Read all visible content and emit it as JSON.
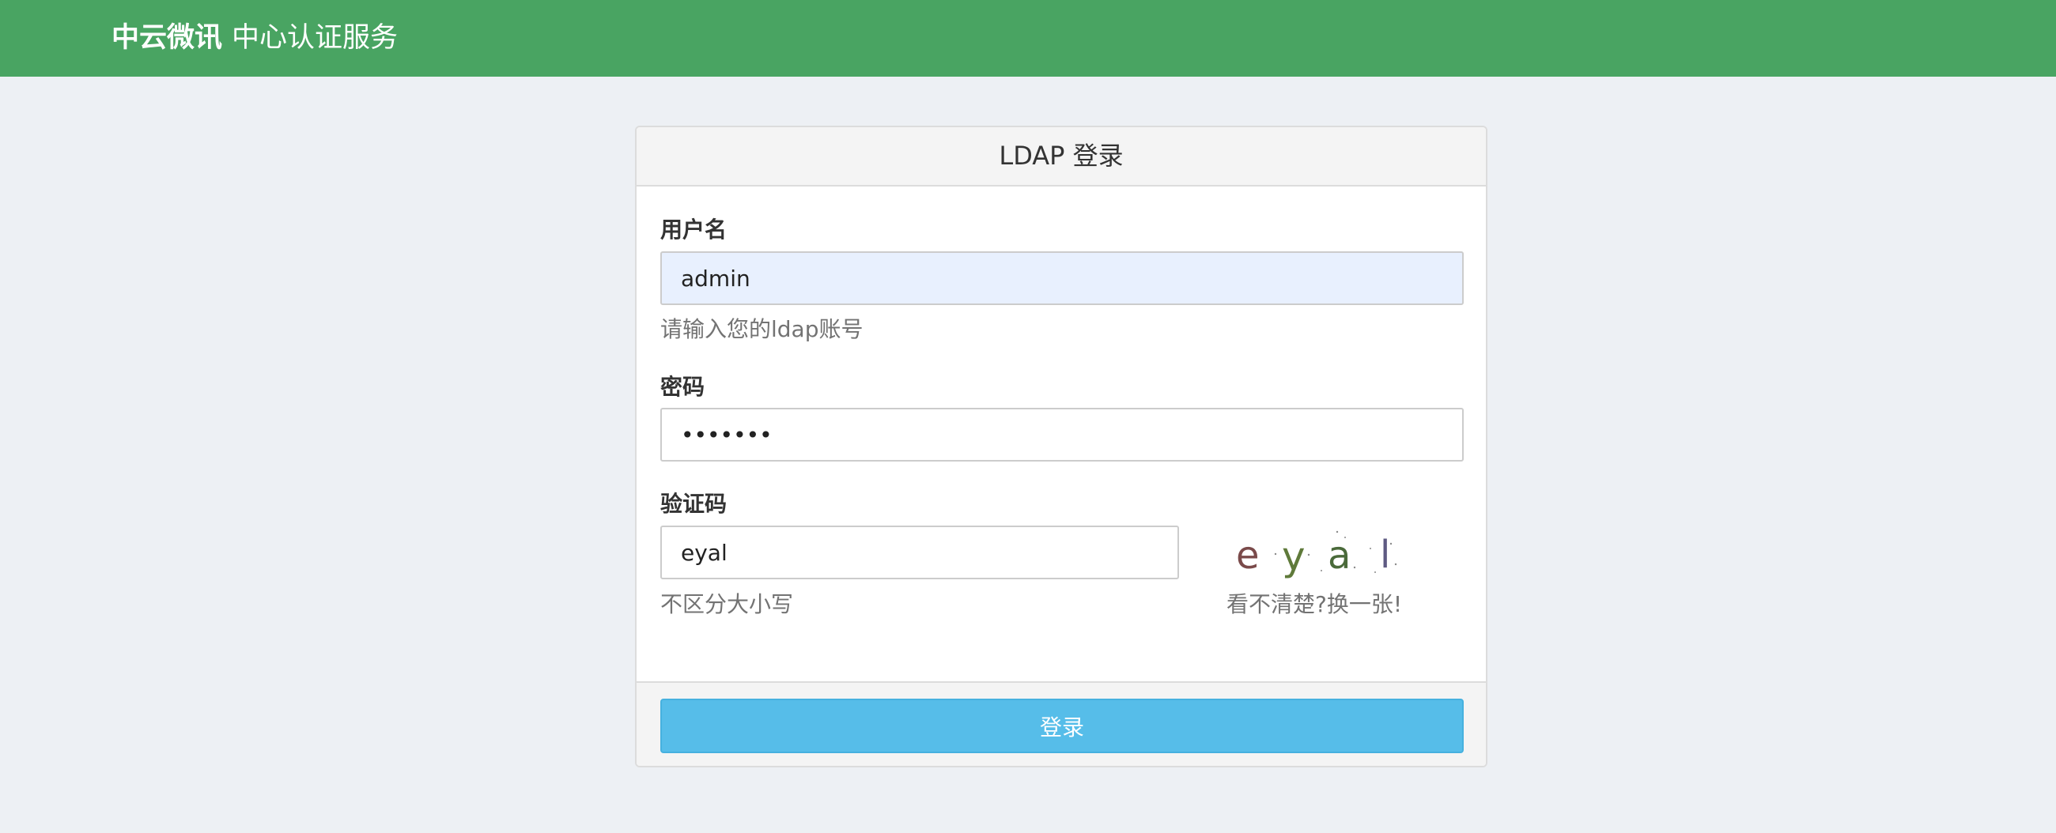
{
  "navbar": {
    "company": "中云微讯",
    "service": "中心认证服务",
    "background_color": "#49a462"
  },
  "panel": {
    "title": "LDAP 登录"
  },
  "form": {
    "username": {
      "label": "用户名",
      "value": "admin",
      "help": "请输入您的ldap账号"
    },
    "password": {
      "label": "密码",
      "value": "1234567"
    },
    "captcha": {
      "label": "验证码",
      "value": "eyal",
      "help": "不区分大小写",
      "image_text": [
        "e",
        "y",
        "a",
        "l"
      ],
      "image_colors": [
        "#7a4a4a",
        "#5f7a3a",
        "#4a6a3a",
        "#5e5a82"
      ],
      "refresh_label": "看不清楚?换一张!"
    }
  },
  "submit": {
    "label": "登录",
    "color": "#56bde9"
  }
}
